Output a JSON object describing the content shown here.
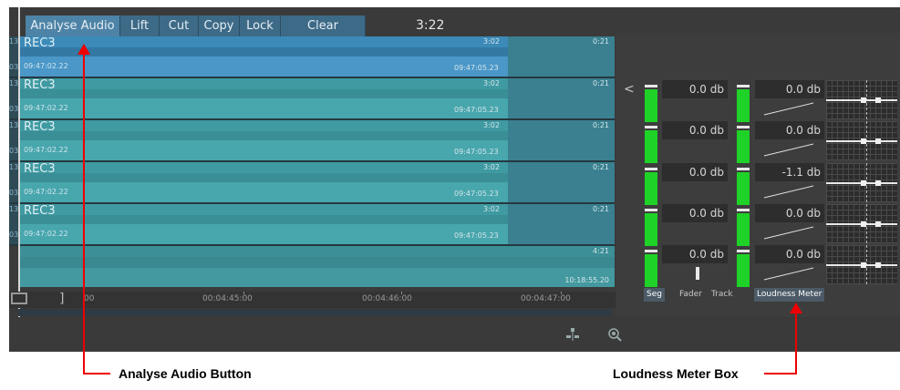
{
  "toolbar": {
    "buttons": [
      {
        "label": "Analyse Audio"
      },
      {
        "label": "Lift"
      },
      {
        "label": "Cut"
      },
      {
        "label": "Copy"
      },
      {
        "label": "Lock"
      },
      {
        "label": "Clear"
      }
    ],
    "timecode": "3:22"
  },
  "tracks": [
    {
      "num": "13",
      "num2": "03",
      "name": "REC3",
      "in": "09:47:02.22",
      "dur": "3:02",
      "out": "09:47:05.23",
      "dur_right": "0:21"
    },
    {
      "num": "13",
      "num2": "03",
      "name": "REC3",
      "in": "09:47:02.22",
      "dur": "3:02",
      "out": "09:47:05.23",
      "dur_right": "0:21"
    },
    {
      "num": "13",
      "num2": "03",
      "name": "REC3",
      "in": "09:47:02.22",
      "dur": "3:02",
      "out": "09:47:05.23",
      "dur_right": "0:21"
    },
    {
      "num": "13",
      "num2": "03",
      "name": "REC3",
      "in": "09:47:02.22",
      "dur": "3:02",
      "out": "09:47:05.23",
      "dur_right": "0:21"
    },
    {
      "num": "13",
      "num2": "03",
      "name": "REC3",
      "in": "09:47:02.22",
      "dur": "3:02",
      "out": "09:47:05.23",
      "dur_right": "0:21"
    }
  ],
  "track6": {
    "dur": "4:21",
    "out": "10:18:55.20"
  },
  "ruler": {
    "labels": [
      "00",
      "00:04:45:00",
      "00:04:46:00",
      "00:04:47:00"
    ],
    "bracket": "]"
  },
  "meters": {
    "collapse_glyph": "<",
    "rows": [
      {
        "seg_db": "0.0 db",
        "track_db": "0.0 db"
      },
      {
        "seg_db": "0.0 db",
        "track_db": "0.0 db"
      },
      {
        "seg_db": "0.0 db",
        "track_db": "-1.1 db"
      },
      {
        "seg_db": "0.0 db",
        "track_db": "0.0 db"
      },
      {
        "seg_db": "0.0 db",
        "track_db": "0.0 db"
      }
    ],
    "tabs": {
      "seg": "Seg",
      "fader": "Fader",
      "track": "Track",
      "loudness": "Loudness Meter"
    }
  },
  "annotations": {
    "analyse": "Analyse Audio Button",
    "loudness": "Loudness Meter Box"
  },
  "colors": {
    "meter_green": "#1fd227",
    "clip_blue": "#3c8ab8",
    "clip_teal": "#3f9aa2",
    "annotation_red": "#e00000"
  }
}
